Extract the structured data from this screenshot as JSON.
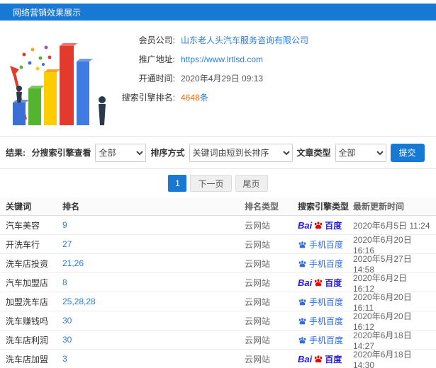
{
  "header": {
    "title": "网络营销效果展示"
  },
  "info": {
    "company_label": "会员公司:",
    "company_value": "山东老人头汽车服务咨询有限公司",
    "url_label": "推广地址:",
    "url_value": "https://www.lrtlsd.com",
    "open_label": "开通时间:",
    "open_value": "2020年4月29日 09:13",
    "rank_label": "搜索引擎排名:",
    "rank_count": "4648",
    "rank_unit": "条"
  },
  "filters": {
    "result_label": "结果:",
    "engine_label": "分搜索引擎查看",
    "engine_value": "全部",
    "sort_label": "排序方式",
    "sort_value": "关键词由短到长排序",
    "article_label": "文章类型",
    "article_value": "全部",
    "submit_label": "提交"
  },
  "pagination": {
    "current": "1",
    "next": "下一页",
    "last": "尾页"
  },
  "table": {
    "headers": [
      "关键词",
      "排名",
      "排名类型",
      "搜索引擎类型",
      "最新更新时间"
    ],
    "engine_labels": {
      "baidu_text": "Bai",
      "baidu_cn": "百度",
      "mobile_text": "手机百度"
    },
    "rows": [
      {
        "keyword": "汽车美容",
        "rank": "9",
        "rank_type": "云网站",
        "engine": "baidu",
        "time": "2020年6月5日 11:24"
      },
      {
        "keyword": "开洗车行",
        "rank": "27",
        "rank_type": "云网站",
        "engine": "mobile",
        "time": "2020年6月20日 16:16"
      },
      {
        "keyword": "洗车店投资",
        "rank": "21,26",
        "rank_type": "云网站",
        "engine": "mobile",
        "time": "2020年5月27日 14:58"
      },
      {
        "keyword": "汽车加盟店",
        "rank": "8",
        "rank_type": "云网站",
        "engine": "baidu",
        "time": "2020年6月2日 16:12"
      },
      {
        "keyword": "加盟洗车店",
        "rank": "25,28,28",
        "rank_type": "云网站",
        "engine": "mobile",
        "time": "2020年6月20日 16:11"
      },
      {
        "keyword": "洗车赚钱吗",
        "rank": "30",
        "rank_type": "云网站",
        "engine": "mobile",
        "time": "2020年6月20日 16:12"
      },
      {
        "keyword": "洗车店利润",
        "rank": "30",
        "rank_type": "云网站",
        "engine": "mobile",
        "time": "2020年6月18日 14:27"
      },
      {
        "keyword": "洗车店加盟",
        "rank": "3",
        "rank_type": "云网站",
        "engine": "baidu",
        "time": "2020年6月18日 14:30"
      }
    ]
  },
  "colors": {
    "accent_blue": "#1779d3",
    "link_blue": "#2a7de0",
    "highlight_orange": "#ff6600",
    "baidu_blue": "#2319dc",
    "baidu_red": "#e10602",
    "mobile_blue": "#2c6de0"
  }
}
